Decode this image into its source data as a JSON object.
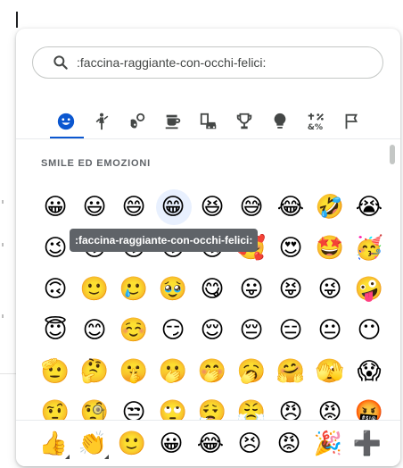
{
  "search": {
    "value": ":faccina-raggiante-con-occhi-felici:"
  },
  "categories": [
    {
      "name": "smileys",
      "active": true
    },
    {
      "name": "people"
    },
    {
      "name": "animals-nature"
    },
    {
      "name": "food-drink"
    },
    {
      "name": "travel-places"
    },
    {
      "name": "activities"
    },
    {
      "name": "objects"
    },
    {
      "name": "symbols"
    },
    {
      "name": "flags"
    }
  ],
  "section_title": "SMILE ED EMOZIONI",
  "tooltip": ":faccina-raggiante-con-occhi-felici:",
  "emoji_rows": [
    [
      "😀",
      "😃",
      "😄",
      "😁",
      "😆",
      "😅",
      "😂",
      "🤣",
      "😭"
    ],
    [
      "😉",
      "😗",
      "😙",
      "😚",
      "😘",
      "🥰",
      "😍",
      "🤩",
      "🥳"
    ],
    [
      "🙃",
      "🙂",
      "🥲",
      "🥹",
      "😋",
      "😛",
      "😝",
      "😜",
      "🤪"
    ],
    [
      "😇",
      "😊",
      "☺️",
      "😏",
      "😌",
      "😔",
      "😑",
      "😐",
      "😶"
    ],
    [
      "🫡",
      "🤔",
      "🤫",
      "🫢",
      "🤭",
      "🥱",
      "🤗",
      "🫣",
      "😱"
    ],
    [
      "🤨",
      "🧐",
      "😒",
      "🙄",
      "😮‍💨",
      "😤",
      "😠",
      "😡",
      "🤬"
    ]
  ],
  "favorites": [
    "👍",
    "👏",
    "🙂",
    "😀",
    "😂",
    "😣",
    "😡",
    "🎉",
    "➕"
  ],
  "colors": {
    "accent": "#0b57d0",
    "icon": "#444746"
  }
}
